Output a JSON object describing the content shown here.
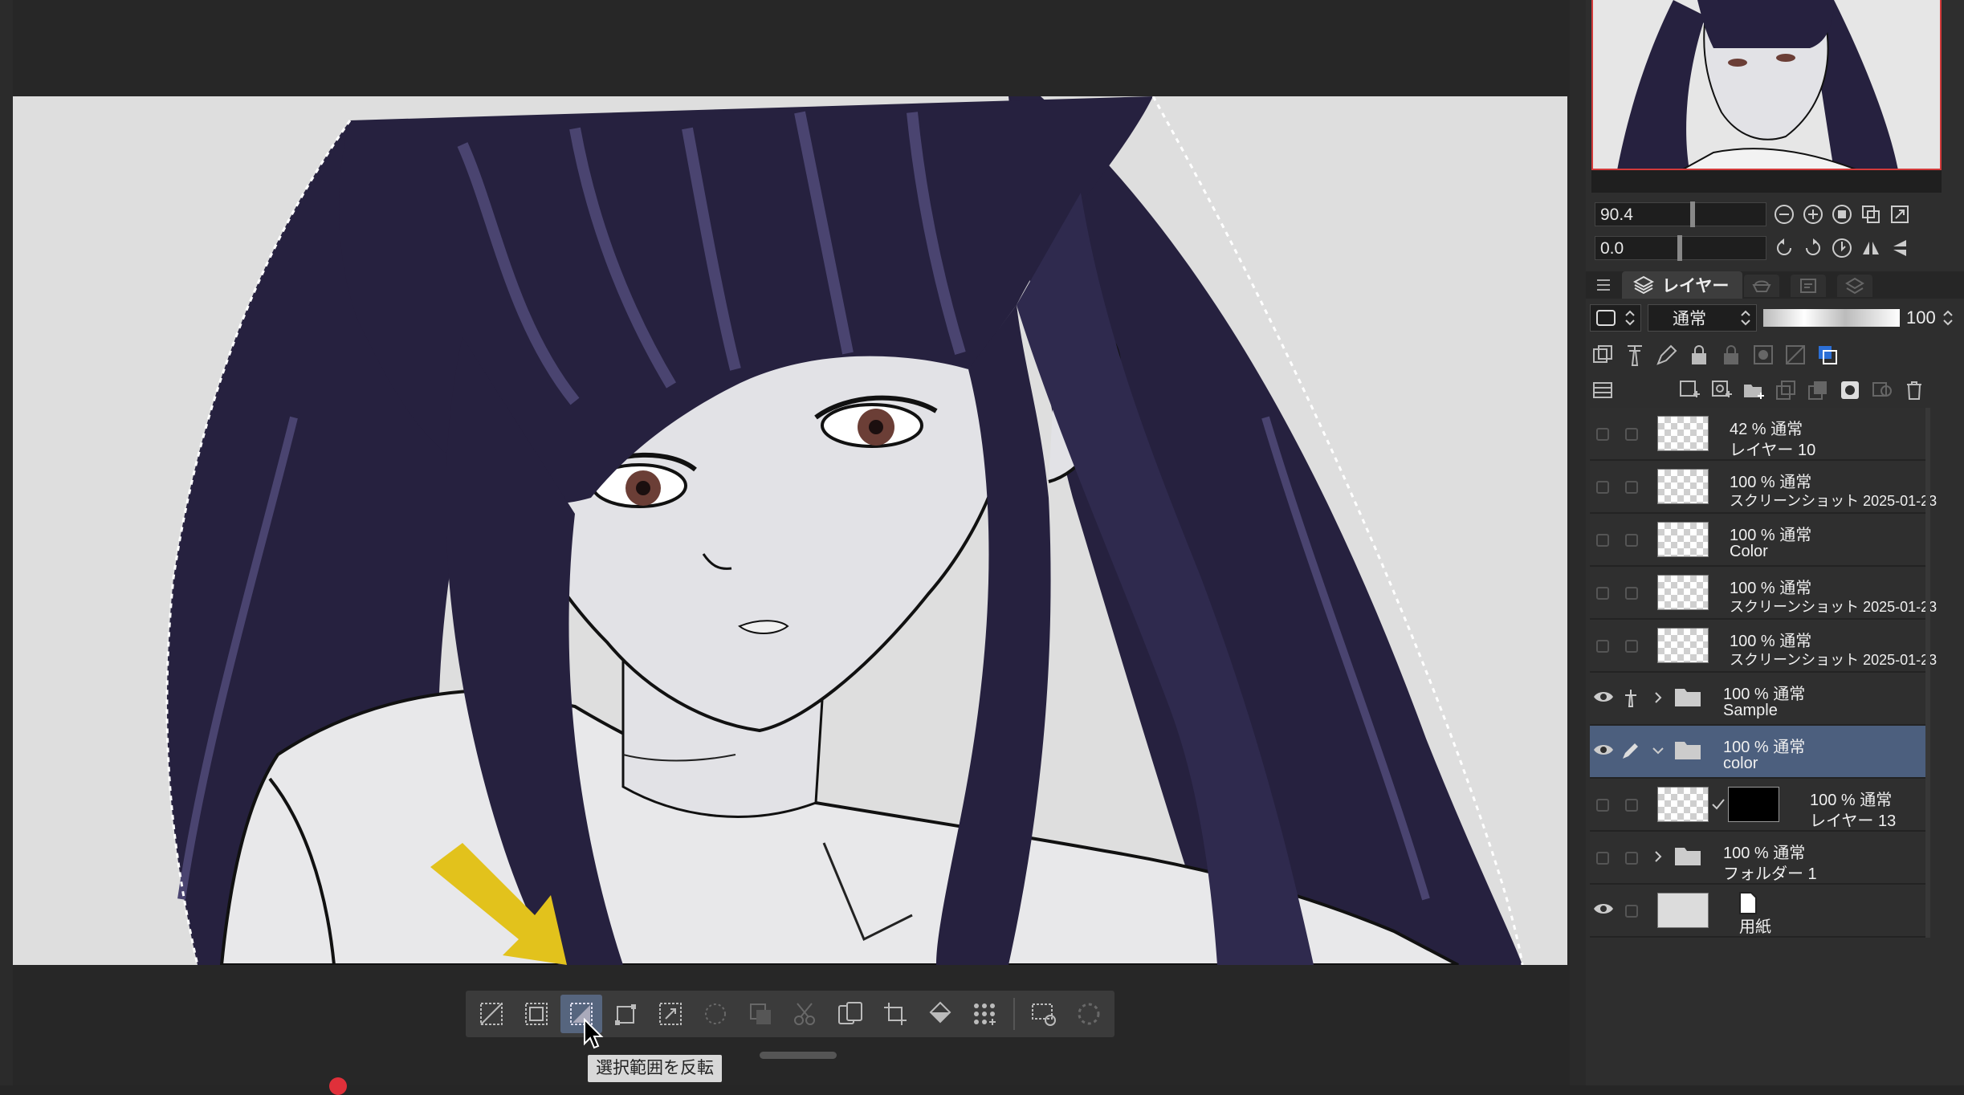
{
  "toolbar": {
    "buttons": [
      {
        "icon": "deselect-icon",
        "state": "normal"
      },
      {
        "icon": "select-all-icon",
        "state": "normal"
      },
      {
        "icon": "invert-selection-icon",
        "state": "active"
      },
      {
        "icon": "scale-rotate-selection-icon",
        "state": "normal"
      },
      {
        "icon": "expand-selection-icon",
        "state": "normal"
      },
      {
        "icon": "shrink-selection-icon",
        "state": "disabled"
      },
      {
        "icon": "copy-paste-selection-icon",
        "state": "disabled"
      },
      {
        "icon": "cut-paste-icon",
        "state": "disabled"
      },
      {
        "icon": "copy-paste-icon",
        "state": "normal"
      },
      {
        "icon": "crop-icon",
        "state": "normal"
      },
      {
        "icon": "fill-icon",
        "state": "normal"
      },
      {
        "icon": "screentone-icon",
        "state": "normal"
      },
      {
        "icon": "selection-settings-icon",
        "state": "normal"
      },
      {
        "icon": "loading-icon",
        "state": "disabled"
      }
    ],
    "tooltip": "選択範囲を反転"
  },
  "navigator": {
    "zoom_value": "90.4",
    "rotate_value": "0.0"
  },
  "layer_panel": {
    "tab_label": "レイヤー",
    "blend_mode": "通常",
    "opacity": "100",
    "layers": [
      {
        "visible": false,
        "type": "raster",
        "line1": "42 % 通常",
        "line2": "レイヤー 10",
        "selected": false
      },
      {
        "visible": false,
        "type": "raster",
        "line1": "100 % 通常",
        "line2": "スクリーンショット 2025-01-23",
        "selected": false
      },
      {
        "visible": false,
        "type": "raster",
        "line1": "100 % 通常",
        "line2": "Color",
        "selected": false
      },
      {
        "visible": false,
        "type": "raster",
        "line1": "100 % 通常",
        "line2": "スクリーンショット 2025-01-23",
        "selected": false
      },
      {
        "visible": false,
        "type": "raster",
        "line1": "100 % 通常",
        "line2": "スクリーンショット 2025-01-23",
        "selected": false
      },
      {
        "visible": true,
        "type": "folder",
        "line1": "100 % 通常",
        "line2": "Sample",
        "selected": false
      },
      {
        "visible": true,
        "type": "folder-open",
        "line1": "100 % 通常",
        "line2": "color",
        "selected": true
      },
      {
        "visible": false,
        "type": "masked",
        "line1": "100 % 通常",
        "line2": "レイヤー 13",
        "selected": false
      },
      {
        "visible": false,
        "type": "folder",
        "line1": "100 % 通常",
        "line2": "フォルダー 1",
        "selected": false
      },
      {
        "visible": true,
        "type": "paper",
        "line1": "",
        "line2": "用紙",
        "selected": false
      }
    ]
  },
  "colors": {
    "canvas_bg": "#dedede",
    "hair": "#26213f",
    "hair_highlight": "#4a4470",
    "skin": "#e2e2e6",
    "arrow": "#e2c21c",
    "selected_layer": "#4c5f7e",
    "active_tool": "#56657e"
  }
}
